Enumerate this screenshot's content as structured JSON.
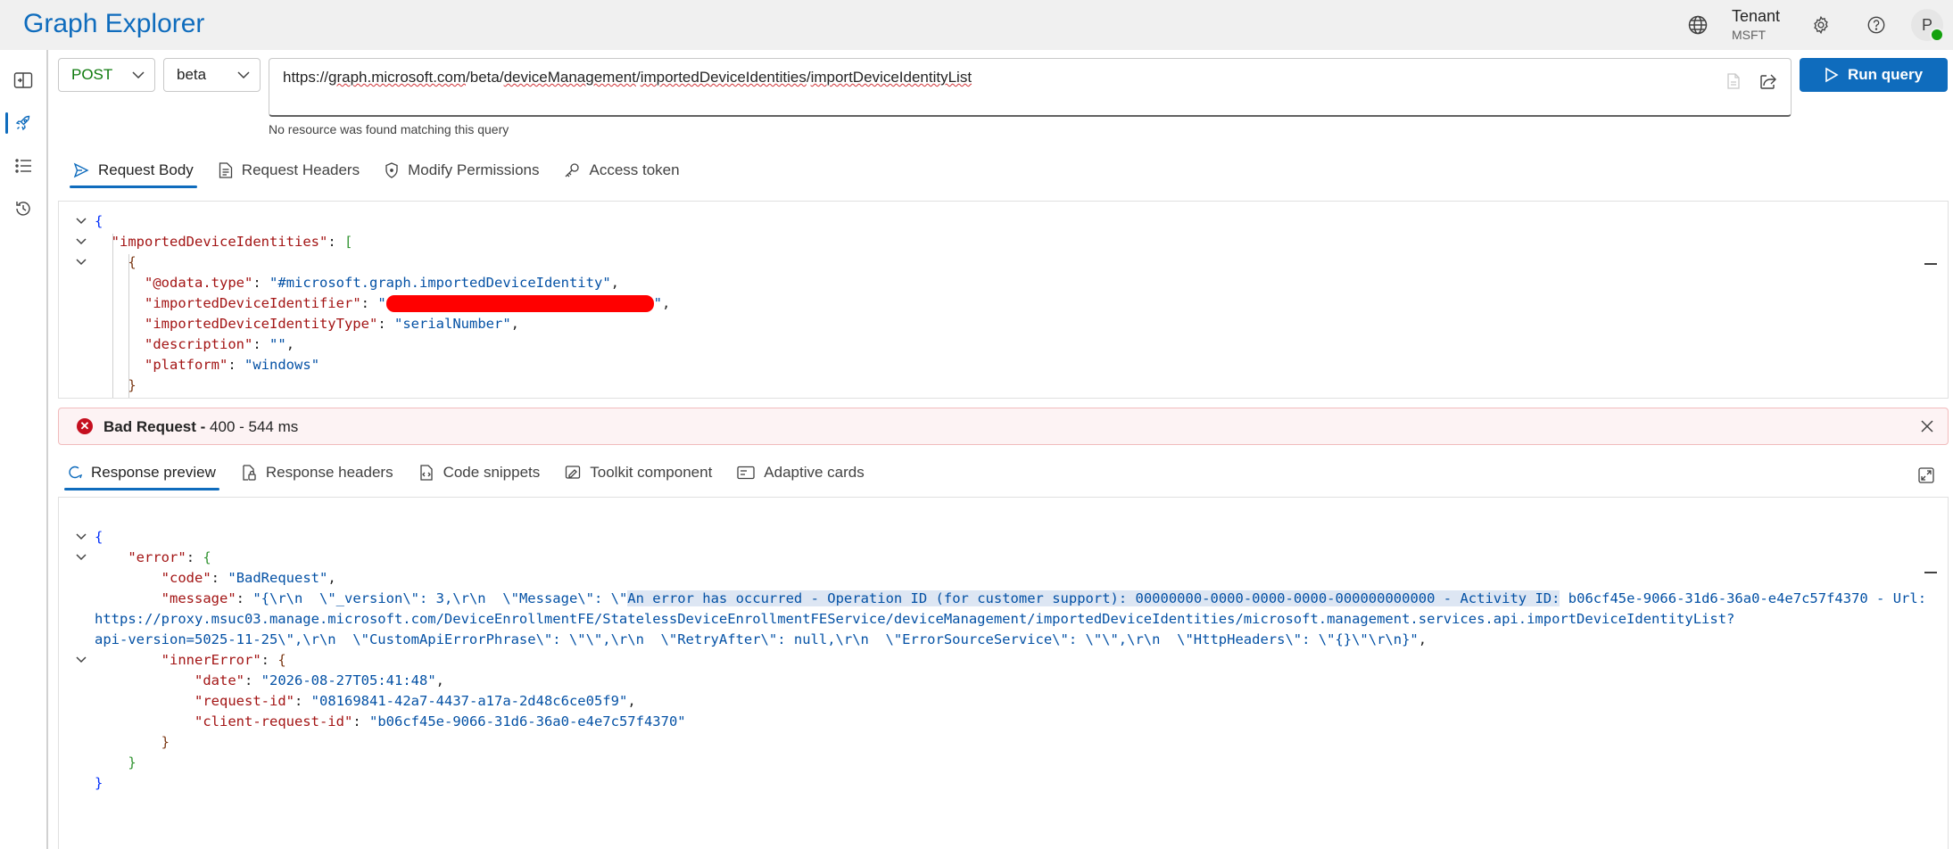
{
  "header": {
    "app_title": "Graph Explorer",
    "tenant_label": "Tenant",
    "tenant_name": "MSFT",
    "avatar_initial": "P"
  },
  "query": {
    "method": "POST",
    "version": "beta",
    "url_prefix": "https://",
    "url_parts": [
      "graph.microsoft.com",
      "/beta/",
      "deviceManagement",
      "/",
      "importedDeviceIdentities",
      "/",
      "importDeviceIdentityList"
    ],
    "run_label": "Run query",
    "no_resource_msg": "No resource was found matching this query"
  },
  "request_tabs": [
    "Request Body",
    "Request Headers",
    "Modify Permissions",
    "Access token"
  ],
  "request_body": {
    "key_root": "importedDeviceIdentities",
    "odata_key": "@odata.type",
    "odata_val": "#microsoft.graph.importedDeviceIdentity",
    "identifier_key": "importedDeviceIdentifier",
    "identity_type_key": "importedDeviceIdentityType",
    "identity_type_val": "serialNumber",
    "description_key": "description",
    "description_val": "",
    "platform_key": "platform",
    "platform_val": "windows"
  },
  "status": {
    "label": "Bad Request -",
    "detail": "400 - 544 ms"
  },
  "response_tabs": [
    "Response preview",
    "Response headers",
    "Code snippets",
    "Toolkit component",
    "Adaptive cards"
  ],
  "response": {
    "error_key": "error",
    "code_key": "code",
    "code_val": "BadRequest",
    "message_key": "message",
    "message_line1_a": "\"{\\r\\n  \\\"_version\\\": 3,\\r\\n  \\\"Message\\\": \\\"",
    "message_line1_hl": "An error has occurred - Operation ID (for customer support): 00000000-0000-0000-0000-000000000000 - Activity ID:",
    "message_line1_b": " b06cf45e-9066-31d6-36a0-e4e7c57f4370 - Url:",
    "message_line2": "https://proxy.msuc03.manage.microsoft.com/DeviceEnrollmentFE/StatelessDeviceEnrollmentFEService/deviceManagement/importedDeviceIdentities/microsoft.management.services.api.importDeviceIdentityList?",
    "message_line3": "api-version=5025-11-25\\\",\\r\\n  \\\"CustomApiErrorPhrase\\\": \\\"\\\",\\r\\n  \\\"RetryAfter\\\": null,\\r\\n  \\\"ErrorSourceService\\\": \\\"\\\",\\r\\n  \\\"HttpHeaders\\\": \\\"{}\\\"\\r\\n}\"",
    "inner_key": "innerError",
    "date_key": "date",
    "date_val": "2026-08-27T05:41:48",
    "reqid_key": "request-id",
    "reqid_val": "08169841-42a7-4437-a17a-2d48c6ce05f9",
    "clientid_key": "client-request-id",
    "clientid_val": "b06cf45e-9066-31d6-36a0-e4e7c57f4370"
  },
  "colors": {
    "accent": "#0f6cbd",
    "error": "#c50f1f",
    "error_bg": "#fdf3f4"
  }
}
